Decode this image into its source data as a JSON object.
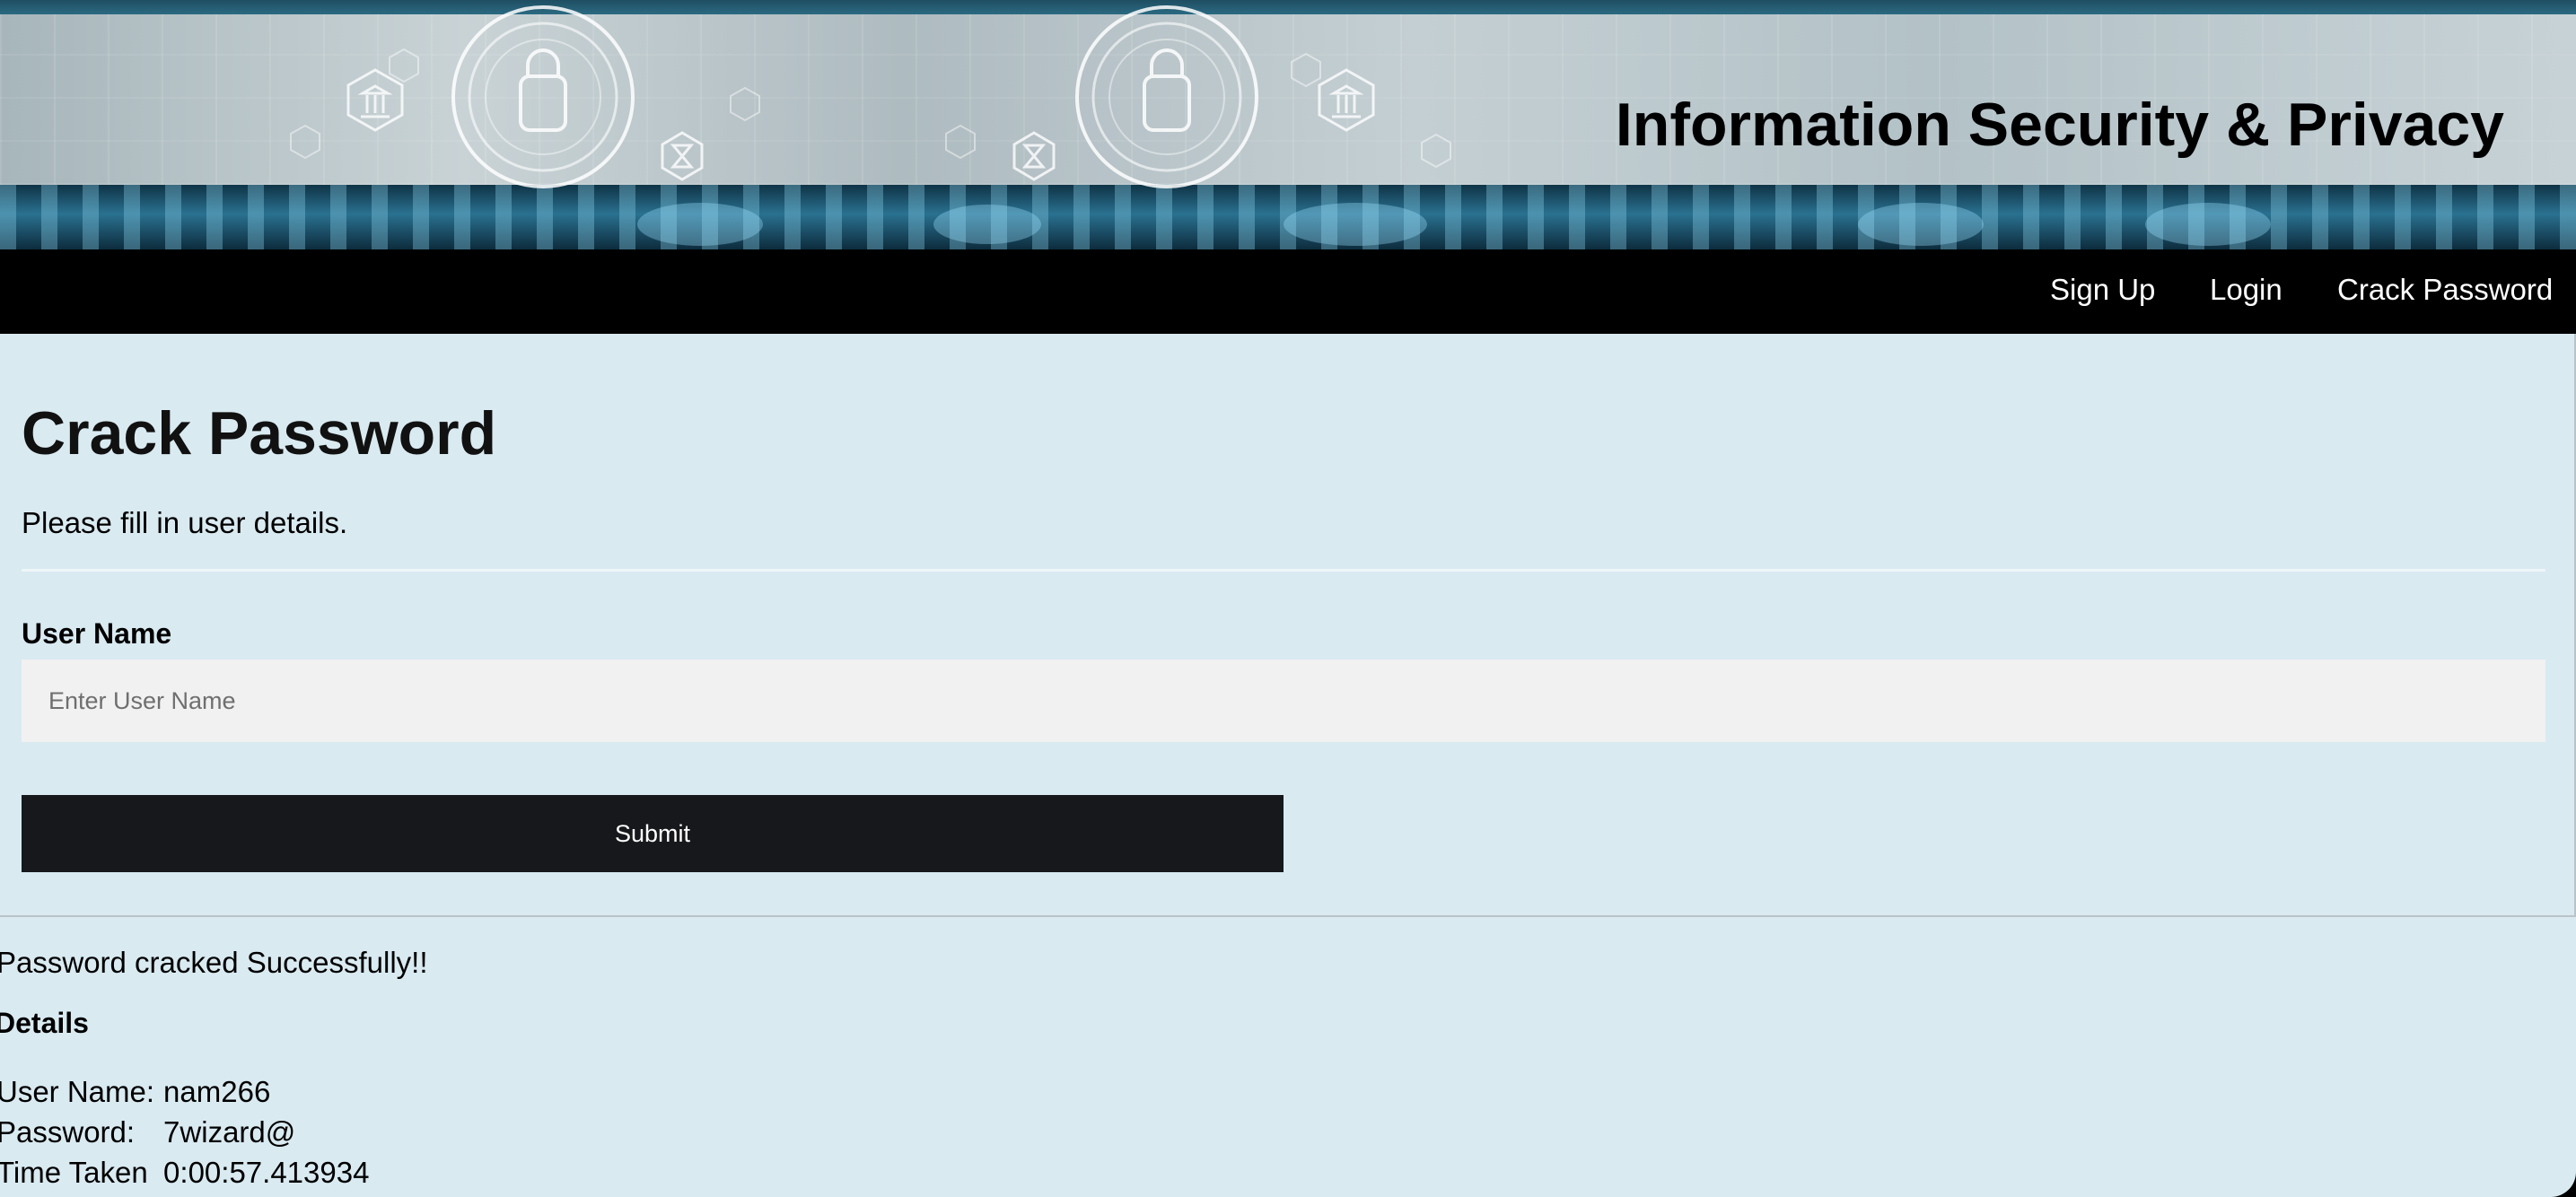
{
  "banner": {
    "title": "Information Security & Privacy"
  },
  "nav": {
    "items": [
      {
        "label": "Sign Up"
      },
      {
        "label": "Login"
      },
      {
        "label": "Crack Password"
      }
    ]
  },
  "form": {
    "title": "Crack Password",
    "subtitle": "Please fill in user details.",
    "username_label": "User Name",
    "username_placeholder": "Enter User Name",
    "username_value": "",
    "submit_label": "Submit"
  },
  "result": {
    "message": "Password cracked Successfully!!",
    "heading": "Details",
    "rows": [
      {
        "key": "User Name:",
        "value": "nam266"
      },
      {
        "key": "Password:",
        "value": "7wizard@"
      },
      {
        "key": "Time Taken",
        "value": "0:00:57.413934"
      }
    ]
  },
  "colors": {
    "page_bg": "#d9eaf1",
    "navbar_bg": "#000000",
    "button_bg": "#16181b",
    "input_bg": "#f1f1f1"
  },
  "icons": [
    "fingerprint-lock-icon",
    "bank-icon",
    "hourglass-icon",
    "circuit-pattern"
  ]
}
